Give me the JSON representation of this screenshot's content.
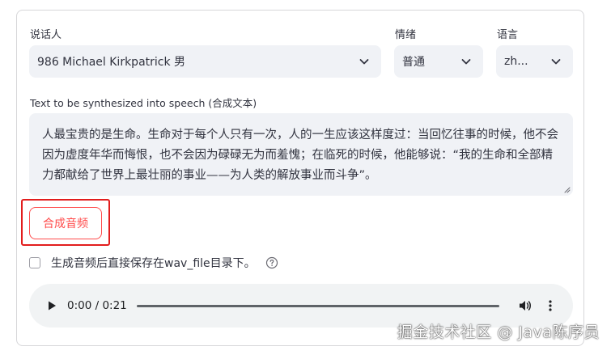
{
  "speaker": {
    "label": "说话人",
    "value": "986 Michael Kirkpatrick 男",
    "icon": "chevron-down-icon"
  },
  "emotion": {
    "label": "情绪",
    "value": "普通",
    "icon": "chevron-down-icon"
  },
  "language": {
    "label": "语言",
    "value": "zh...",
    "icon": "chevron-down-icon"
  },
  "text_input": {
    "label": "Text to be synthesized into speech (合成文本)",
    "value": "人最宝贵的是生命。生命对于每个人只有一次，人的一生应该这样度过：当回忆往事的时候，他不会因为虚度年华而悔恨，也不会因为碌碌无为而羞愧；在临死的时候，他能够说：“我的生命和全部精力都献给了世界上最壮丽的事业——为人类的解放事业而斗争”。"
  },
  "synthesize_button": {
    "label": "合成音频",
    "accent_color": "#ff4b4b",
    "highlight_color": "#e21d1d"
  },
  "save_option": {
    "label": "生成音频后直接保存在wav_file目录下。",
    "checked": false,
    "help_icon": "question-circle-icon"
  },
  "audio_player": {
    "time_display": "0:00 / 0:21",
    "progress": 0,
    "play_icon": "play-icon",
    "volume_icon": "volume-icon",
    "more_icon": "more-vertical-icon"
  },
  "watermark": "掘金技术社区 @ Java陈序员"
}
